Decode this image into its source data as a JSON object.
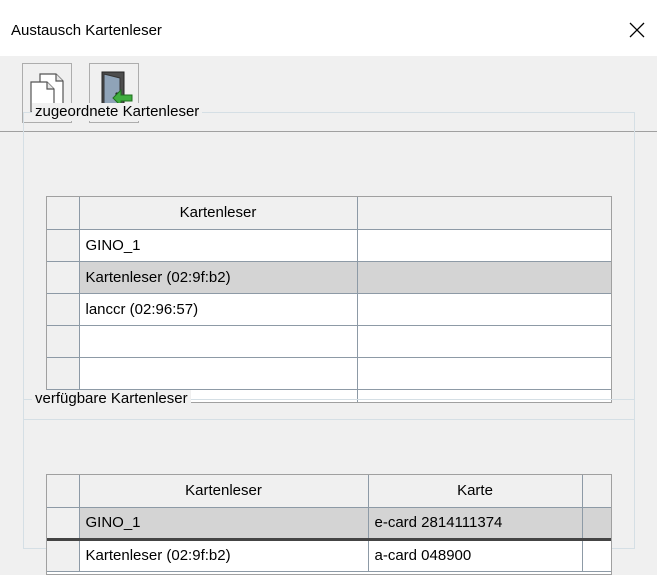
{
  "window": {
    "title": "Austausch Kartenleser"
  },
  "toolbar": {
    "buttons": [
      {
        "icon": "new-document-icon"
      },
      {
        "icon": "exit-door-icon"
      }
    ]
  },
  "assigned": {
    "legend": "zugeordnete Kartenleser",
    "columns": [
      "Kartenleser",
      ""
    ],
    "rows": [
      {
        "reader": "GINO_1",
        "extra": ""
      },
      {
        "reader": "Kartenleser (02:9f:b2)",
        "extra": "",
        "selected": true
      },
      {
        "reader": "lanccr (02:96:57)",
        "extra": ""
      },
      {
        "reader": "",
        "extra": ""
      },
      {
        "reader": "",
        "extra": ""
      },
      {
        "reader": "",
        "extra": ""
      }
    ]
  },
  "available": {
    "legend": "verfügbare Kartenleser",
    "columns": [
      "Kartenleser",
      "Karte",
      ""
    ],
    "rows": [
      {
        "reader": "GINO_1",
        "card": "e-card 2814111374",
        "selected": true
      },
      {
        "reader": "Kartenleser (02:9f:b2)",
        "card": "a-card 048900"
      }
    ]
  },
  "colors": {
    "selected_row": "#d4d4d4",
    "grid_line": "#8d9aa6",
    "dialog_bg": "#f0f0f0"
  }
}
